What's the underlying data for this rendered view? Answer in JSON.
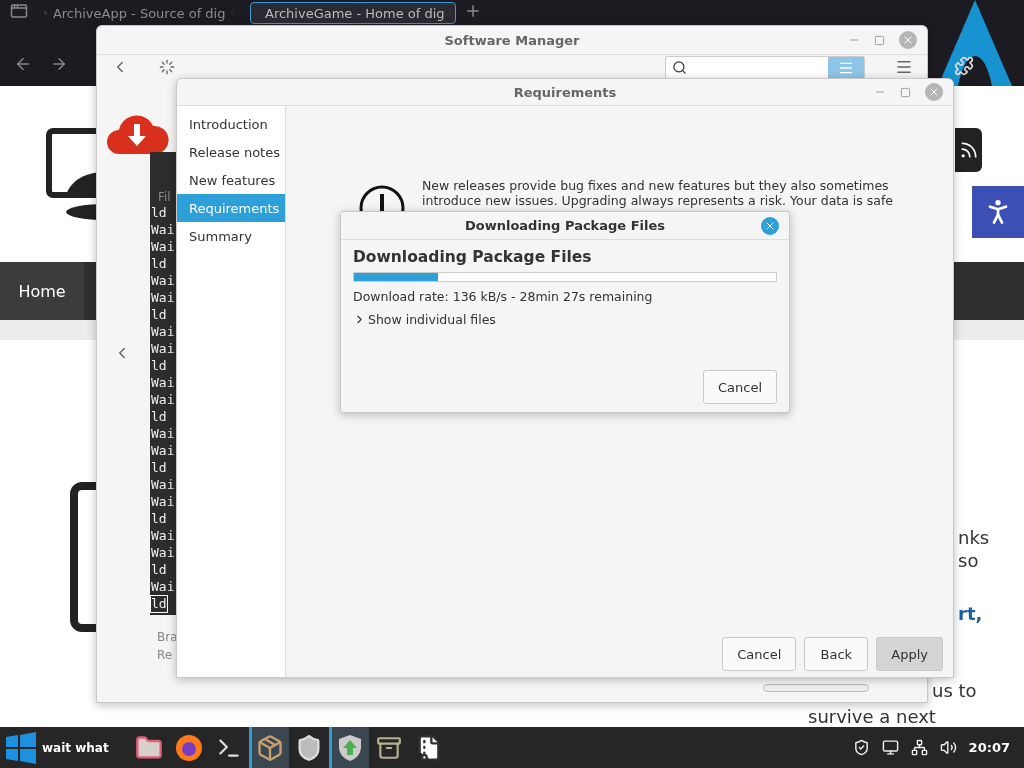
{
  "browser": {
    "tabs": [
      {
        "label": "ArchiveApp - Source of dig",
        "selected": false
      },
      {
        "label": "ArchiveGame - Home of dig",
        "selected": true
      }
    ],
    "nav": [
      {
        "label": "Home",
        "selected": true
      }
    ],
    "page_text": [
      "nks",
      "so",
      "rt,",
      "us to",
      "survive a next"
    ]
  },
  "software_manager": {
    "title": "Software Manager",
    "details": [
      "Bra",
      "Re"
    ]
  },
  "terminal": {
    "menu": "Fil",
    "lines": [
      "ld",
      "Wai",
      "Wai",
      "ld",
      "Wai",
      "Wai",
      "ld",
      "Wai",
      "Wai",
      "ld",
      "Wai",
      "Wai",
      "ld",
      "Wai",
      "Wai",
      "ld",
      "Wai",
      "Wai",
      "ld",
      "Wai",
      "Wai",
      "ld",
      "Wai",
      "ld"
    ]
  },
  "upgrade_window": {
    "title": "Requirements",
    "steps": [
      {
        "label": "Introduction",
        "selected": false
      },
      {
        "label": "Release notes",
        "selected": false
      },
      {
        "label": "New features",
        "selected": false
      },
      {
        "label": "Requirements",
        "selected": true
      },
      {
        "label": "Summary",
        "selected": false
      }
    ],
    "message": [
      "New releases provide bug fixes and new features but they also sometimes",
      "introduce new issues. Upgrading always represents a risk. Your data is safe"
    ],
    "buttons": [
      {
        "label": "Cancel",
        "kind": "normal"
      },
      {
        "label": "Back",
        "kind": "normal"
      },
      {
        "label": "Apply",
        "kind": "suggested"
      }
    ]
  },
  "download_dialog": {
    "title": "Downloading Package Files",
    "heading": "Downloading Package Files",
    "progress": {
      "level": 0.2
    },
    "rate": "Download rate: 136 kB/s - 28min 27s remaining",
    "expander": {
      "label": "Show individual files",
      "expanded": false
    },
    "button": "Cancel"
  },
  "taskbar": {
    "start_label": "wait what",
    "apps": [
      {
        "kind": "folder",
        "selected": false
      },
      {
        "kind": "firefox",
        "selected": false
      },
      {
        "kind": "terminal",
        "selected": false
      },
      {
        "kind": "package",
        "selected": true
      },
      {
        "kind": "shield",
        "selected": false
      },
      {
        "kind": "updater",
        "selected": true
      },
      {
        "kind": "archive",
        "selected": false
      },
      {
        "kind": "zip",
        "selected": false
      }
    ],
    "clock": "20:07"
  }
}
